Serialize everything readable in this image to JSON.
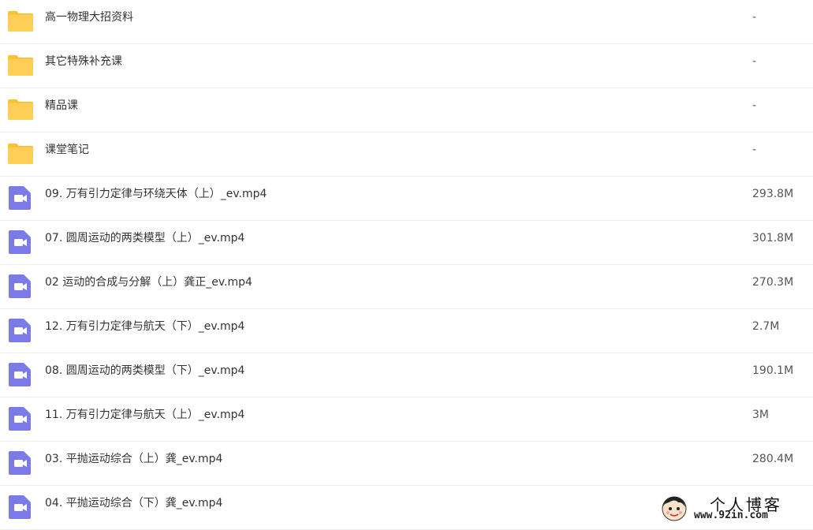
{
  "files": [
    {
      "name": "高一物理大招资料",
      "size": "-",
      "type": "folder",
      "icon": "folder-icon"
    },
    {
      "name": "其它特殊补充课",
      "size": "-",
      "type": "folder",
      "icon": "folder-icon"
    },
    {
      "name": "精品课",
      "size": "-",
      "type": "folder",
      "icon": "folder-icon"
    },
    {
      "name": "课堂笔记",
      "size": "-",
      "type": "folder",
      "icon": "folder-icon"
    },
    {
      "name": "09. 万有引力定律与环绕天体（上）_ev.mp4",
      "size": "293.8M",
      "type": "video",
      "icon": "video-file-icon"
    },
    {
      "name": "07. 圆周运动的两类模型（上）_ev.mp4",
      "size": "301.8M",
      "type": "video",
      "icon": "video-file-icon"
    },
    {
      "name": "02 运动的合成与分解（上）龚正_ev.mp4",
      "size": "270.3M",
      "type": "video",
      "icon": "video-file-icon"
    },
    {
      "name": "12. 万有引力定律与航天（下）_ev.mp4",
      "size": "2.7M",
      "type": "video",
      "icon": "video-file-icon"
    },
    {
      "name": "08. 圆周运动的两类模型（下）_ev.mp4",
      "size": "190.1M",
      "type": "video",
      "icon": "video-file-icon"
    },
    {
      "name": "11. 万有引力定律与航天（上）_ev.mp4",
      "size": "3M",
      "type": "video",
      "icon": "video-file-icon"
    },
    {
      "name": "03. 平抛运动综合（上）龚_ev.mp4",
      "size": "280.4M",
      "type": "video",
      "icon": "video-file-icon"
    },
    {
      "name": "04. 平抛运动综合（下）龚_ev.mp4",
      "size": "",
      "type": "video",
      "icon": "video-file-icon"
    }
  ],
  "watermark": {
    "title": "个人博客",
    "url": "www.92in.com"
  },
  "colors": {
    "folder": "#FFCE56",
    "folder_tab": "#FFC233",
    "video": "#7B7BE8",
    "divider": "#EEEEEE",
    "text": "#333333"
  }
}
